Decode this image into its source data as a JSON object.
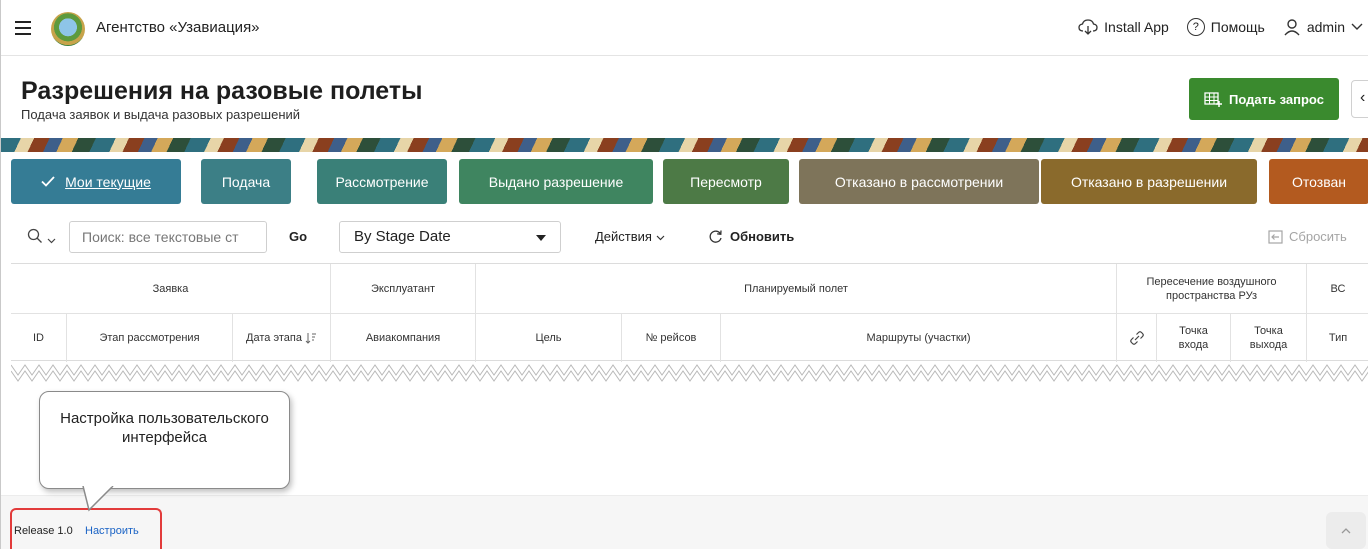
{
  "header": {
    "app_title": "Агентство «Узавиация»",
    "install_app": "Install App",
    "help": "Помощь",
    "user": "admin"
  },
  "hero": {
    "title": "Разрешения на разовые полеты",
    "subtitle": "Подача заявок и выдача разовых разрешений",
    "submit_button": "Подать запрос"
  },
  "tabs": [
    {
      "label": "Мои текущие",
      "color": "#357c95"
    },
    {
      "label": "Подача",
      "color": "#3c7f86"
    },
    {
      "label": "Рассмотрение",
      "color": "#3a8078"
    },
    {
      "label": "Выдано разрешение",
      "color": "#3f8560"
    },
    {
      "label": "Пересмотр",
      "color": "#4d7a46"
    },
    {
      "label": "Отказано в рассмотрении",
      "color": "#7e745a"
    },
    {
      "label": "Отказано в разрешении",
      "color": "#8a6a2c"
    },
    {
      "label": "Отозван",
      "color": "#b35a1f"
    }
  ],
  "toolbar": {
    "search_placeholder": "Поиск: все текстовые ст",
    "go": "Go",
    "report_select": "By Stage Date",
    "actions": "Действия",
    "refresh": "Обновить",
    "reset": "Сбросить"
  },
  "grid": {
    "groups": {
      "application": "Заявка",
      "operator": "Эксплуатант",
      "planned_flight": "Планируемый полет",
      "airspace": "Пересечение воздушного пространства РУз",
      "aircraft": "ВС"
    },
    "columns": {
      "id": "ID",
      "stage": "Этап рассмотрения",
      "stage_date": "Дата этапа",
      "airline": "Авиакомпания",
      "purpose": "Цель",
      "flight_numbers": "№ рейсов",
      "routes": "Маршруты (участки)",
      "entry_point": "Точка входа",
      "exit_point": "Точка выхода",
      "type": "Тип"
    }
  },
  "callout": {
    "text": "Настройка пользовательского интерфейса"
  },
  "footer": {
    "release": "Release 1.0",
    "customize": "Настроить"
  }
}
